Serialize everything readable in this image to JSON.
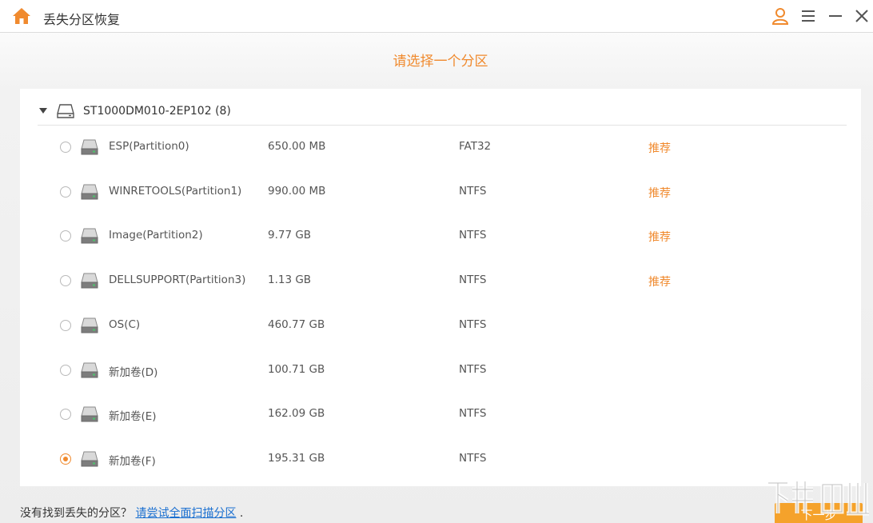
{
  "titlebar": {
    "title": "丢失分区恢复",
    "icons": [
      "home-icon",
      "user-icon",
      "menu-icon",
      "minimize-icon",
      "close-icon"
    ]
  },
  "heading": "请选择一个分区",
  "disk": {
    "label": "ST1000DM010-2EP102 (8)",
    "expanded": true
  },
  "partitions": [
    {
      "name": "ESP(Partition0)",
      "size": "650.00 MB",
      "fs": "FAT32",
      "tag": "推荐",
      "selected": false
    },
    {
      "name": "WINRETOOLS(Partition1)",
      "size": "990.00 MB",
      "fs": "NTFS",
      "tag": "推荐",
      "selected": false
    },
    {
      "name": "Image(Partition2)",
      "size": "9.77 GB",
      "fs": "NTFS",
      "tag": "推荐",
      "selected": false
    },
    {
      "name": "DELLSUPPORT(Partition3)",
      "size": "1.13 GB",
      "fs": "NTFS",
      "tag": "推荐",
      "selected": false
    },
    {
      "name": "OS(C)",
      "size": "460.77 GB",
      "fs": "NTFS",
      "tag": "",
      "selected": false
    },
    {
      "name": "新加卷(D)",
      "size": "100.71 GB",
      "fs": "NTFS",
      "tag": "",
      "selected": false
    },
    {
      "name": "新加卷(E)",
      "size": "162.09 GB",
      "fs": "NTFS",
      "tag": "",
      "selected": false
    },
    {
      "name": "新加卷(F)",
      "size": "195.31 GB",
      "fs": "NTFS",
      "tag": "",
      "selected": true
    }
  ],
  "footer": {
    "question": "没有找到丢失的分区？",
    "link": "请尝试全面扫描分区",
    "period": "."
  },
  "next_button": "下一步",
  "colors": {
    "accent": "#f08a2e",
    "link": "#1a6fd0",
    "button": "#f5a22b"
  }
}
